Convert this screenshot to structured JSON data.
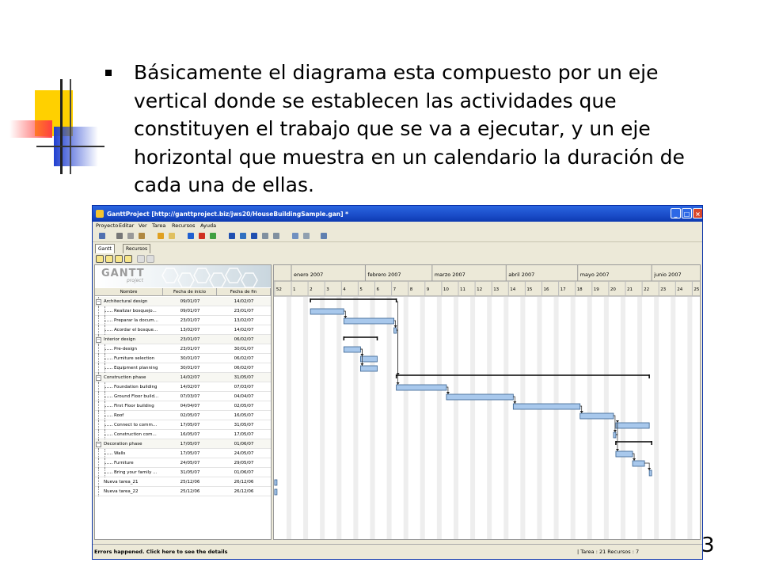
{
  "slide": {
    "bullet_text": "Básicamente el diagrama esta compuesto por un eje vertical donde se establecen las actividades que constituyen el trabajo que se va a ejecutar, y un eje horizontal que muestra en un calendario la duración de cada una de ellas.",
    "page_number": "3"
  },
  "window": {
    "title": "GanttProject [http://ganttproject.biz/jws20/HouseBuildingSample.gan] *",
    "controls": {
      "minimize": "_",
      "maximize": "□",
      "close": "×"
    }
  },
  "menu": [
    "Proyecto",
    "Editar",
    "Ver",
    "Tarea",
    "Recursos",
    "Ayuda"
  ],
  "tabs": [
    {
      "label": "Gantt",
      "active": true
    },
    {
      "label": "Recursos",
      "active": false
    }
  ],
  "logo": {
    "name": "GANTT",
    "sub": "project"
  },
  "columns": {
    "name": "Nombre",
    "start": "Fecha de inicio",
    "end": "Fecha de fin"
  },
  "tasks": [
    {
      "name": "Architectural design",
      "start": "09/01/07",
      "end": "14/02/07",
      "level": 0,
      "group": true
    },
    {
      "name": "Realizar bosquejo...",
      "start": "09/01/07",
      "end": "23/01/07",
      "level": 1
    },
    {
      "name": "Preparar la docum...",
      "start": "23/01/07",
      "end": "13/02/07",
      "level": 1
    },
    {
      "name": "Acordar el bosque...",
      "start": "13/02/07",
      "end": "14/02/07",
      "level": 1
    },
    {
      "name": "Interior design",
      "start": "23/01/07",
      "end": "06/02/07",
      "level": 0,
      "group": true
    },
    {
      "name": "Pre-design",
      "start": "23/01/07",
      "end": "30/01/07",
      "level": 1
    },
    {
      "name": "Furniture selection",
      "start": "30/01/07",
      "end": "06/02/07",
      "level": 1
    },
    {
      "name": "Equipment planning",
      "start": "30/01/07",
      "end": "06/02/07",
      "level": 1
    },
    {
      "name": "Construction phase",
      "start": "14/02/07",
      "end": "31/05/07",
      "level": 0,
      "group": true
    },
    {
      "name": "Foundation building",
      "start": "14/02/07",
      "end": "07/03/07",
      "level": 1
    },
    {
      "name": "Ground Floor build...",
      "start": "07/03/07",
      "end": "04/04/07",
      "level": 1
    },
    {
      "name": "First Floor building",
      "start": "04/04/07",
      "end": "02/05/07",
      "level": 1
    },
    {
      "name": "Roof",
      "start": "02/05/07",
      "end": "16/05/07",
      "level": 1
    },
    {
      "name": "Connect to comm...",
      "start": "17/05/07",
      "end": "31/05/07",
      "level": 1
    },
    {
      "name": "Construction com...",
      "start": "16/05/07",
      "end": "17/05/07",
      "level": 1
    },
    {
      "name": "Decoration phase",
      "start": "17/05/07",
      "end": "01/06/07",
      "level": 0,
      "group": true
    },
    {
      "name": "Walls",
      "start": "17/05/07",
      "end": "24/05/07",
      "level": 1
    },
    {
      "name": "Furniture",
      "start": "24/05/07",
      "end": "29/05/07",
      "level": 1
    },
    {
      "name": "Bring your family ...",
      "start": "31/05/07",
      "end": "01/06/07",
      "level": 1
    },
    {
      "name": "Nueva tarea_21",
      "start": "25/12/06",
      "end": "26/12/06",
      "level": 0
    },
    {
      "name": "Nueva tarea_22",
      "start": "25/12/06",
      "end": "26/12/06",
      "level": 0
    }
  ],
  "timeline": {
    "months": [
      "enero 2007",
      "febrero 2007",
      "marzo 2007",
      "abril 2007",
      "mayo 2007",
      "junio 2007"
    ],
    "weeks": [
      "52",
      "1",
      "2",
      "3",
      "4",
      "5",
      "6",
      "7",
      "8",
      "9",
      "10",
      "11",
      "12",
      "13",
      "14",
      "15",
      "16",
      "17",
      "18",
      "19",
      "20",
      "21",
      "22",
      "23",
      "24",
      "25"
    ]
  },
  "status": {
    "error": "Errors happened. Click here to see the details",
    "counts": "| Tarea : 21  Recursos : 7"
  },
  "colors": {
    "bar": "#a8c8ec",
    "bar_border": "#36608f",
    "title": "#1a4cc8"
  }
}
